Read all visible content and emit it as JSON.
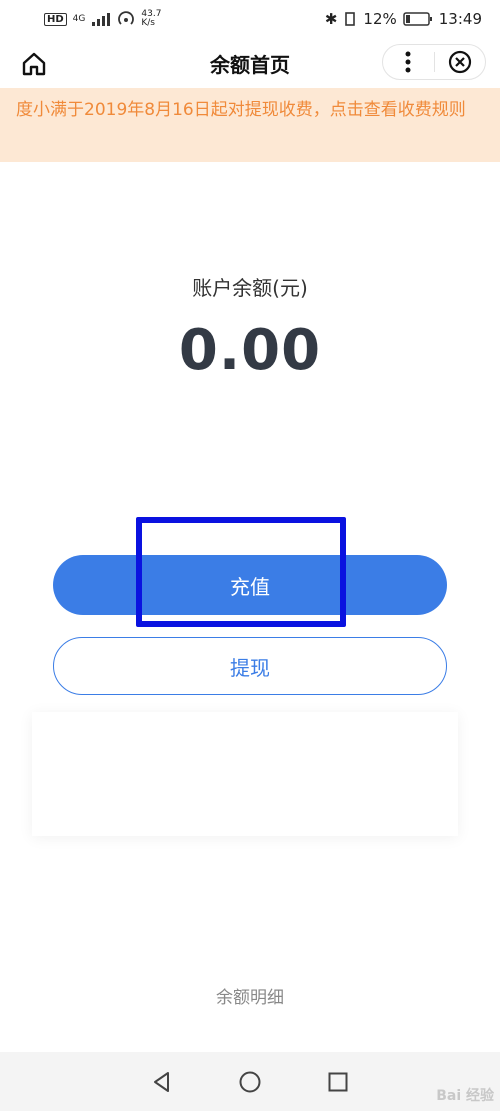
{
  "status_bar": {
    "hd": "HD",
    "network": "4G",
    "speed": "43.7",
    "speed_unit": "K/s",
    "battery": "12%",
    "time": "13:49"
  },
  "nav": {
    "title": "余额首页"
  },
  "notice": {
    "text": "度小满于2019年8月16日起对提现收费，点击查看收费规则"
  },
  "balance": {
    "label": "账户余额(元)",
    "amount": "0.00"
  },
  "buttons": {
    "recharge": "充值",
    "withdraw": "提现"
  },
  "footer": {
    "detail_link": "余额明细"
  },
  "watermark": "Bai 经验",
  "colors": {
    "accent": "#3b7de6",
    "notice_bg": "#fde8d4",
    "notice_text": "#f08a3a",
    "highlight": "#0a12e0"
  }
}
